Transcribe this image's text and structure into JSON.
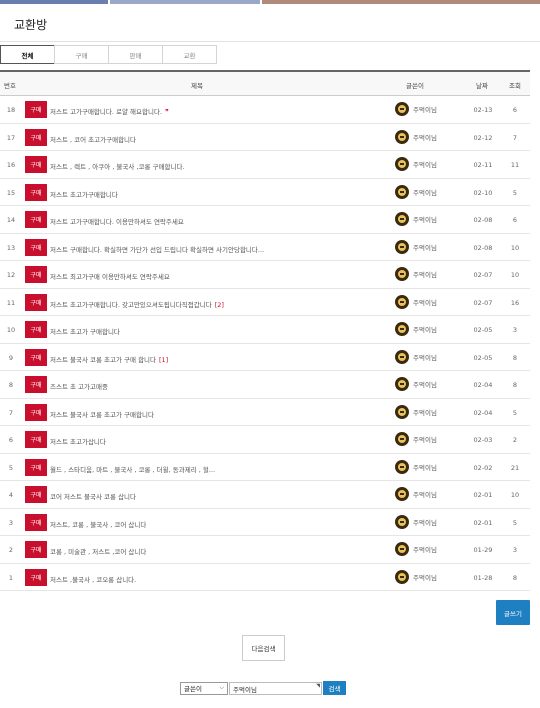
{
  "page": {
    "title": "교환방"
  },
  "colors": {
    "badge": "#c8102e",
    "accent": "#1e80c0",
    "comment_count": "#c8102e"
  },
  "tabs": [
    {
      "label": "전체",
      "active": true
    },
    {
      "label": "구매",
      "active": false
    },
    {
      "label": "판매",
      "active": false
    },
    {
      "label": "교환",
      "active": false
    }
  ],
  "table": {
    "headers": {
      "no": "번호",
      "subject": "제목",
      "author": "글쓴이",
      "date": "날짜",
      "views": "조회"
    },
    "rows": [
      {
        "no": "18",
        "category": "구매",
        "subject": "저스트 고가구매합니다. 로얄 해요합니다.",
        "comments": "",
        "new": true,
        "author": "주먹이님",
        "date": "02-13",
        "views": "6"
      },
      {
        "no": "17",
        "category": "구매",
        "subject": "저스트 , 코어 초고가구매합니다",
        "comments": "",
        "new": false,
        "author": "주먹이님",
        "date": "02-12",
        "views": "7"
      },
      {
        "no": "16",
        "category": "구매",
        "subject": "저스트 , 렉트 , 아쿠아 , 불국사 ,코롱 구매합니다.",
        "comments": "",
        "new": false,
        "author": "주먹이님",
        "date": "02-11",
        "views": "11"
      },
      {
        "no": "15",
        "category": "구매",
        "subject": "저스트 초고가구매합니다",
        "comments": "",
        "new": false,
        "author": "주먹이님",
        "date": "02-10",
        "views": "5"
      },
      {
        "no": "14",
        "category": "구매",
        "subject": "저스트 고가구매합니다. 이용만하셔도 연락주세요",
        "comments": "",
        "new": false,
        "author": "주먹이님",
        "date": "02-08",
        "views": "6"
      },
      {
        "no": "13",
        "category": "구매",
        "subject": "저스트 구매합니다. 확실하면 가단가 선입 드립니다 확실하면 사기안당합니다...",
        "comments": "",
        "new": false,
        "author": "주먹이님",
        "date": "02-08",
        "views": "10"
      },
      {
        "no": "12",
        "category": "구매",
        "subject": "저스트 최고가구매 이용만하셔도 연락주세요",
        "comments": "",
        "new": false,
        "author": "주먹이님",
        "date": "02-07",
        "views": "10"
      },
      {
        "no": "11",
        "category": "구매",
        "subject": "저스트 초고가구매합니다. 갖고만있으셔도됩니다직접갑니다",
        "comments": "[2]",
        "new": false,
        "author": "주먹이님",
        "date": "02-07",
        "views": "16"
      },
      {
        "no": "10",
        "category": "구매",
        "subject": "저스트 초고가 구매합니다",
        "comments": "",
        "new": false,
        "author": "주먹이님",
        "date": "02-05",
        "views": "3"
      },
      {
        "no": "9",
        "category": "구매",
        "subject": "저스트 불국사 코롱 초고가 구매 합니다",
        "comments": "[1]",
        "new": false,
        "author": "주먹이님",
        "date": "02-05",
        "views": "8"
      },
      {
        "no": "8",
        "category": "구매",
        "subject": "즈스트 초 고가고매중",
        "comments": "",
        "new": false,
        "author": "주먹이님",
        "date": "02-04",
        "views": "8"
      },
      {
        "no": "7",
        "category": "구매",
        "subject": "저스트 불국사 코롱 초고가 구매합니다",
        "comments": "",
        "new": false,
        "author": "주먹이님",
        "date": "02-04",
        "views": "5"
      },
      {
        "no": "6",
        "category": "구매",
        "subject": "저스트 초고가삽니다",
        "comments": "",
        "new": false,
        "author": "주먹이님",
        "date": "02-03",
        "views": "2"
      },
      {
        "no": "5",
        "category": "구매",
        "subject": "월드 , 스타디움, 마트 , 불국사 , 코롱 , 더윌, 동과제리 , 헐...",
        "comments": "",
        "new": false,
        "author": "주먹이님",
        "date": "02-02",
        "views": "21"
      },
      {
        "no": "4",
        "category": "구매",
        "subject": "코어 저스트 불국사 코롱 삽니다",
        "comments": "",
        "new": false,
        "author": "주먹이님",
        "date": "02-01",
        "views": "10"
      },
      {
        "no": "3",
        "category": "구매",
        "subject": "저스트, 코롱 , 불국사 , 코어 삽니다",
        "comments": "",
        "new": false,
        "author": "주먹이님",
        "date": "02-01",
        "views": "5"
      },
      {
        "no": "2",
        "category": "구매",
        "subject": "코롱 , 미술관 , 저스트 ,코어 삽니다",
        "comments": "",
        "new": false,
        "author": "주먹이님",
        "date": "01-29",
        "views": "3"
      },
      {
        "no": "1",
        "category": "구매",
        "subject": "저스트 ,불국사 , 코오롱 삽니다.",
        "comments": "",
        "new": false,
        "author": "주먹이님",
        "date": "01-28",
        "views": "8"
      }
    ]
  },
  "buttons": {
    "write": "글쓰기",
    "next_search": "다음검색"
  },
  "search": {
    "field": "글쓴이",
    "query": "주먹이님",
    "button": "검색",
    "select_icon": "chevron-down-icon"
  }
}
